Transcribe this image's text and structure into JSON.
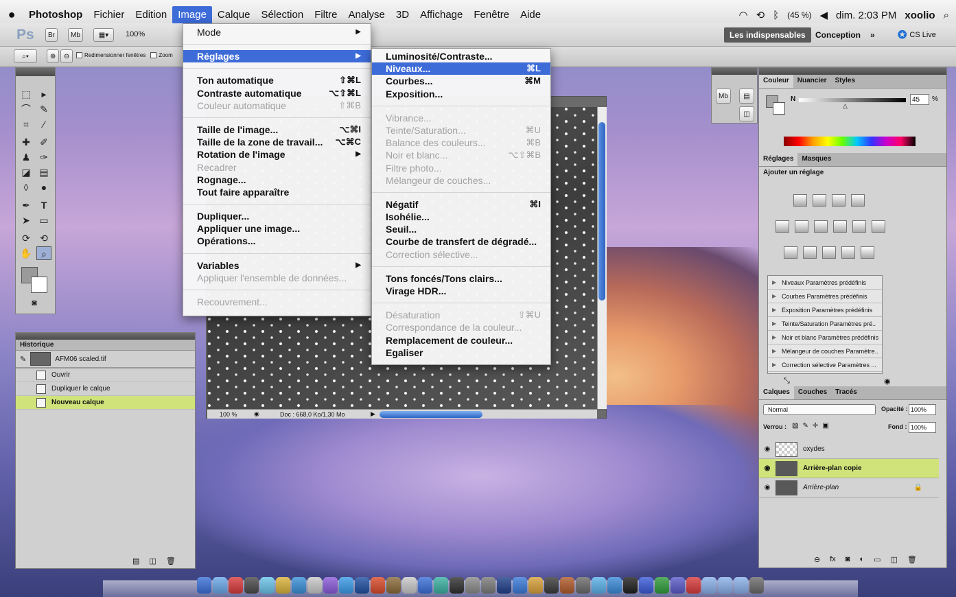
{
  "menubar": {
    "app": "Photoshop",
    "items": [
      "Fichier",
      "Edition",
      "Image",
      "Calque",
      "Sélection",
      "Filtre",
      "Analyse",
      "3D",
      "Affichage",
      "Fenêtre",
      "Aide"
    ],
    "selected": "Image",
    "status": {
      "battery": "(45 %)",
      "clock": "dim. 2:03 PM",
      "user": "xoolio"
    }
  },
  "optionsbar": {
    "zoom": "100%",
    "workspaces": [
      "Les indispensables",
      "Conception"
    ],
    "cslive": "CS Live",
    "resize_label": "Redimensionner fenêtres",
    "zoom_label": "Zoom"
  },
  "image_menu": [
    {
      "label": "Mode",
      "sub": true
    },
    {
      "sep": true
    },
    {
      "label": "Réglages",
      "sub": true,
      "hl": true
    },
    {
      "sep": true
    },
    {
      "label": "Ton automatique",
      "sc": "⇧⌘L",
      "bold": true
    },
    {
      "label": "Contraste automatique",
      "sc": "⌥⇧⌘L",
      "bold": true
    },
    {
      "label": "Couleur automatique",
      "sc": "⇧⌘B",
      "dis": true
    },
    {
      "sep": true
    },
    {
      "label": "Taille de l'image...",
      "sc": "⌥⌘I",
      "bold": true
    },
    {
      "label": "Taille de la zone de travail...",
      "sc": "⌥⌘C",
      "bold": true
    },
    {
      "label": "Rotation de l'image",
      "sub": true,
      "bold": true
    },
    {
      "label": "Recadrer",
      "dis": true
    },
    {
      "label": "Rognage...",
      "bold": true
    },
    {
      "label": "Tout faire apparaître",
      "bold": true
    },
    {
      "sep": true
    },
    {
      "label": "Dupliquer...",
      "bold": true
    },
    {
      "label": "Appliquer une image...",
      "bold": true
    },
    {
      "label": "Opérations...",
      "bold": true
    },
    {
      "sep": true
    },
    {
      "label": "Variables",
      "sub": true,
      "bold": true
    },
    {
      "label": "Appliquer l'ensemble de données...",
      "dis": true
    },
    {
      "sep": true
    },
    {
      "label": "Recouvrement...",
      "dis": true
    }
  ],
  "adjust_menu": [
    {
      "label": "Luminosité/Contraste...",
      "bold": true
    },
    {
      "label": "Niveaux...",
      "sc": "⌘L",
      "hl": true
    },
    {
      "label": "Courbes...",
      "sc": "⌘M",
      "bold": true
    },
    {
      "label": "Exposition...",
      "bold": true
    },
    {
      "sep": true
    },
    {
      "label": "Vibrance...",
      "dis": true
    },
    {
      "label": "Teinte/Saturation...",
      "sc": "⌘U",
      "dis": true
    },
    {
      "label": "Balance des couleurs...",
      "sc": "⌘B",
      "dis": true
    },
    {
      "label": "Noir et blanc...",
      "sc": "⌥⇧⌘B",
      "dis": true
    },
    {
      "label": "Filtre photo...",
      "dis": true
    },
    {
      "label": "Mélangeur de couches...",
      "dis": true
    },
    {
      "sep": true
    },
    {
      "label": "Négatif",
      "sc": "⌘I",
      "bold": true
    },
    {
      "label": "Isohélie...",
      "bold": true
    },
    {
      "label": "Seuil...",
      "bold": true
    },
    {
      "label": "Courbe de transfert de dégradé...",
      "bold": true
    },
    {
      "label": "Correction sélective...",
      "dis": true
    },
    {
      "sep": true
    },
    {
      "label": "Tons foncés/Tons clairs...",
      "bold": true
    },
    {
      "label": "Virage HDR...",
      "bold": true
    },
    {
      "sep": true
    },
    {
      "label": "Désaturation",
      "sc": "⇧⌘U",
      "dis": true
    },
    {
      "label": "Correspondance de la couleur...",
      "dis": true
    },
    {
      "label": "Remplacement de couleur...",
      "bold": true
    },
    {
      "label": "Egaliser",
      "bold": true
    }
  ],
  "history": {
    "title": "Historique",
    "snapshot": "AFM06 scaled.tif",
    "steps": [
      "Ouvrir",
      "Dupliquer le calque",
      "Nouveau calque"
    ]
  },
  "document": {
    "zoom": "100 %",
    "info": "Doc : 668,0 Ko/1,30 Mo"
  },
  "color_panel": {
    "tabs": [
      "Couleur",
      "Nuancier",
      "Styles"
    ],
    "channel": "N",
    "value": "45",
    "unit": "%"
  },
  "adjust_panel": {
    "tabs": [
      "Réglages",
      "Masques"
    ],
    "heading": "Ajouter un réglage",
    "presets": [
      "Niveaux Paramètres prédéfinis",
      "Courbes Paramètres prédéfinis",
      "Exposition Paramètres prédéfinis",
      "Teinte/Saturation Paramètres pré..",
      "Noir et blanc Paramètres prédéfinis",
      "Mélangeur de couches Paramètre..",
      "Correction sélective Paramètres ..."
    ]
  },
  "layers_panel": {
    "tabs": [
      "Calques",
      "Couches",
      "Tracés"
    ],
    "blend": "Normal",
    "opacity_label": "Opacité :",
    "opacity": "100%",
    "lock_label": "Verrou :",
    "fill_label": "Fond :",
    "fill": "100%",
    "layers": [
      {
        "name": "oxydes"
      },
      {
        "name": "Arrière-plan copie",
        "active": true
      },
      {
        "name": "Arrière-plan",
        "locked": true
      }
    ]
  }
}
